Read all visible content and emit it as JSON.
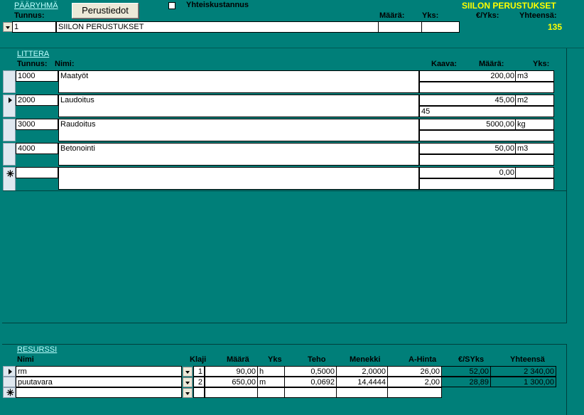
{
  "header": {
    "section_title": "PÄÄRYHMÄ",
    "perustiedot_button": "Perustiedot",
    "checkbox_label": "Yhteiskustannus",
    "group_title": "SIILON PERUSTUKSET",
    "col_tunnus": "Tunnus:",
    "col_maara": "Määrä:",
    "col_yks": "Yks:",
    "col_eur_yks": "€/Yks:",
    "col_yhteensa": "Yhteensä:",
    "tunnus_value": "1",
    "name_value": "SIILON PERUSTUKSET",
    "maara_value": "",
    "yks_value": "",
    "yhteensa_value": "135"
  },
  "littera": {
    "section_title": "LITTERA",
    "col_tunnus": "Tunnus:",
    "col_nimi": "Nimi:",
    "col_kaava": "Kaava:",
    "col_maara": "Määrä:",
    "col_yks": "Yks:",
    "rows": [
      {
        "tunnus": "1000",
        "nimi": "Maatyöt",
        "maara": "200,00",
        "yks": "m3",
        "kaava": ""
      },
      {
        "tunnus": "2000",
        "nimi": "Laudoitus",
        "maara": "45,00",
        "yks": "m2",
        "kaava": "45"
      },
      {
        "tunnus": "3000",
        "nimi": "Raudoitus",
        "maara": "5000,00",
        "yks": "kg",
        "kaava": ""
      },
      {
        "tunnus": "4000",
        "nimi": "Betonointi",
        "maara": "50,00",
        "yks": "m3",
        "kaava": ""
      },
      {
        "tunnus": "",
        "nimi": "",
        "maara": "0,00",
        "yks": "",
        "kaava": ""
      }
    ]
  },
  "resurssi": {
    "section_title": "RESURSSI",
    "col_nimi": "Nimi",
    "col_laji": "Klaji",
    "col_maara": "Määrä",
    "col_yks": "Yks",
    "col_teho": "Teho",
    "col_menekki": "Menekki",
    "col_ahinta": "A-Hinta",
    "col_eursyks": "€/SYks",
    "col_yhteensa": "Yhteensä",
    "rows": [
      {
        "nimi": "rm",
        "laji": "1",
        "maara": "90,00",
        "yks": "h",
        "teho": "0,5000",
        "menekki": "2,0000",
        "ahinta": "26,00",
        "eursyks": "52,00",
        "yhteensa": "2 340,00"
      },
      {
        "nimi": "puutavara",
        "laji": "2",
        "maara": "650,00",
        "yks": "m",
        "teho": "0,0692",
        "menekki": "14,4444",
        "ahinta": "2,00",
        "eursyks": "28,89",
        "yhteensa": "1 300,00"
      }
    ]
  },
  "colors": {
    "teal": "#007f79",
    "yellow": "#ffff00",
    "link": "#bfffff"
  }
}
